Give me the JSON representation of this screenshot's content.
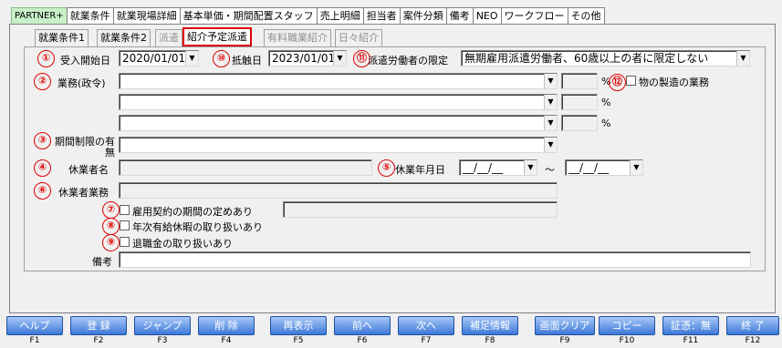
{
  "top_tabs": [
    "PARTNER+",
    "就業条件",
    "就業現場詳細",
    "基本単価・期間配置スタッフ",
    "売上明細",
    "担当者",
    "案件分類",
    "備考",
    "NEO",
    "ワークフロー",
    "その他"
  ],
  "sub_tabs": [
    {
      "label": "就業条件1",
      "state": "normal"
    },
    {
      "label": "就業条件2",
      "state": "normal"
    },
    {
      "label": "派遣",
      "state": "disabled"
    },
    {
      "label": "紹介予定派遣",
      "state": "active"
    },
    {
      "label": "有料職業紹介",
      "state": "disabled"
    },
    {
      "label": "日々紹介",
      "state": "disabled"
    }
  ],
  "markers": [
    "①",
    "②",
    "③",
    "④",
    "⑤",
    "⑥",
    "⑦",
    "⑧",
    "⑨",
    "⑩",
    "⑪",
    "⑫"
  ],
  "form": {
    "accept_start_label": "受入開始日",
    "accept_start_value": "2020/01/01",
    "conflict_date_label": "抵触日",
    "conflict_date_value": "2023/01/01",
    "limit_label": "派遣労働者の限定",
    "limit_value": "無期雇用派遣労働者、60歳以上の者に限定しない",
    "business_label": "業務(政令)",
    "percent": "%",
    "manufacturing_label": "物の製造の業務",
    "period_limit_label": "期間制限の有無",
    "absentee_name_label": "休業者名",
    "absence_date_label": "休業年月日",
    "absence_date_from": "__/__/__",
    "absence_date_to": "__/__/__",
    "tilde": "〜",
    "absentee_job_label": "休業者業務",
    "employment_period_label": "雇用契約の期間の定めあり",
    "paid_leave_label": "年次有給休暇の取り扱いあり",
    "retirement_label": "退職金の取り扱いあり",
    "remarks_label": "備考"
  },
  "function_keys": [
    {
      "label": "ヘルプ",
      "key": "F1"
    },
    {
      "label": "登 録",
      "key": "F2"
    },
    {
      "label": "ジャンプ",
      "key": "F3"
    },
    {
      "label": "削 除",
      "key": "F4"
    },
    {
      "label": "再表示",
      "key": "F5"
    },
    {
      "label": "前へ",
      "key": "F6"
    },
    {
      "label": "次へ",
      "key": "F7"
    },
    {
      "label": "補足情報",
      "key": "F8"
    },
    {
      "label": "画面クリア",
      "key": "F9"
    },
    {
      "label": "コピー",
      "key": "F10"
    },
    {
      "label": "証憑：無",
      "key": "F11"
    },
    {
      "label": "終 了",
      "key": "F12"
    }
  ],
  "colors": {
    "marker": "#e00000",
    "fn_button": "#3c78d8",
    "brand_tab": "#c8f0c8"
  }
}
